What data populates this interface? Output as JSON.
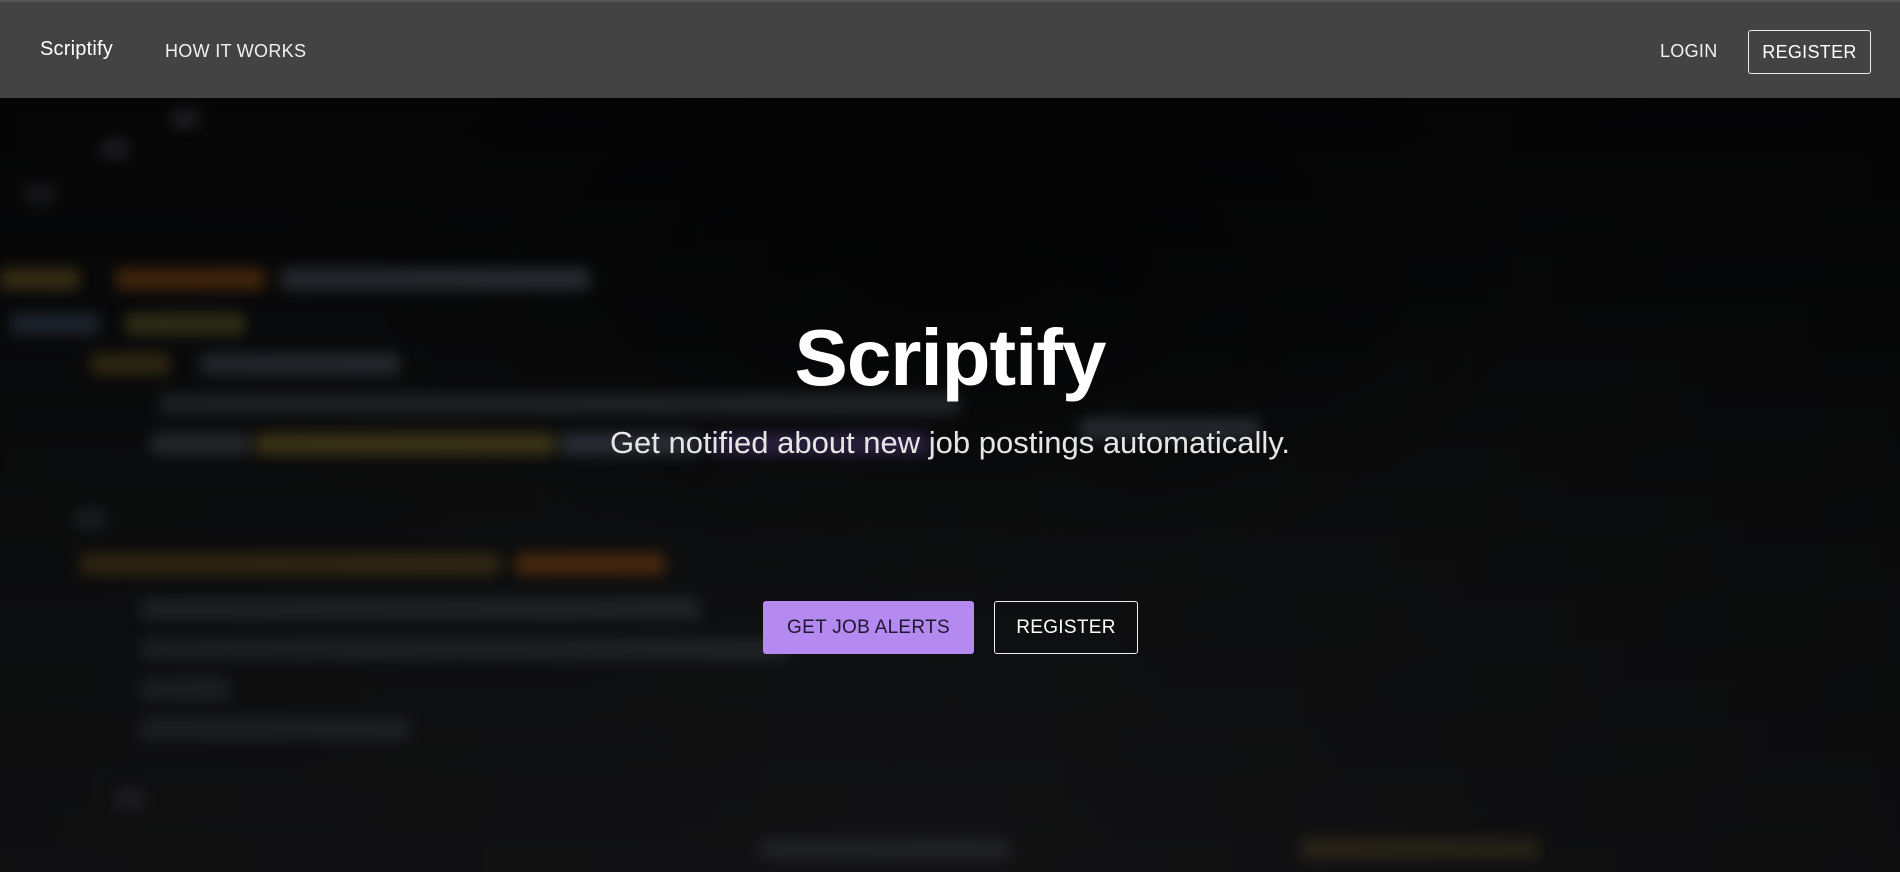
{
  "navbar": {
    "brand": "Scriptify",
    "how_it_works": "HOW IT WORKS",
    "login": "LOGIN",
    "register": "REGISTER"
  },
  "hero": {
    "title": "Scriptify",
    "subtitle": "Get notified about new job postings automatically.",
    "primary_button": "GET JOB ALERTS",
    "secondary_button": "REGISTER"
  },
  "colors": {
    "navbar_bg": "#434343",
    "accent": "#b48af0",
    "hero_bg": "#0b0b0c"
  }
}
